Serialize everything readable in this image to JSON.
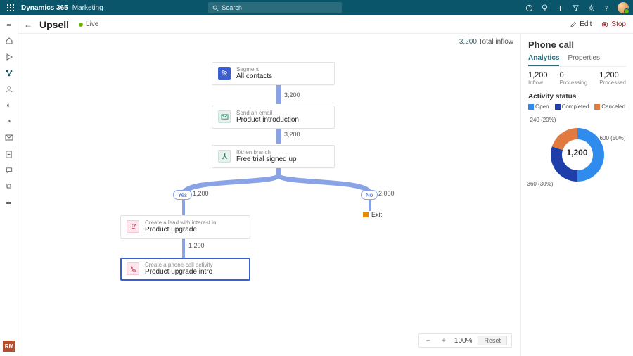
{
  "topbar": {
    "brand": "Dynamics 365",
    "app": "Marketing",
    "search_placeholder": "Search"
  },
  "page": {
    "title": "Upsell",
    "status": "Live",
    "edit_label": "Edit",
    "stop_label": "Stop"
  },
  "rm_badge": "RM",
  "canvas": {
    "total_inflow_value": "3,200",
    "total_inflow_label": "Total inflow",
    "zoom": "100%",
    "reset_label": "Reset",
    "nodes": {
      "segment": {
        "type": "Segment",
        "title": "All contacts"
      },
      "email": {
        "type": "Send an email",
        "title": "Product introduction"
      },
      "branch": {
        "type": "If/then branch",
        "title": "Free trial signed up"
      },
      "lead": {
        "type": "Create a lead with interest in",
        "title": "Product upgrade"
      },
      "phone": {
        "type": "Create a phone-call activity",
        "title": "Product upgrade intro"
      }
    },
    "edge_labels": {
      "seg_email": "3,200",
      "email_branch": "3,200",
      "yes": "Yes",
      "yes_count": "1,200",
      "no": "No",
      "no_count": "2,000",
      "lead_phone": "1,200",
      "exit": "Exit"
    }
  },
  "sidepanel": {
    "title": "Phone call",
    "tabs": {
      "analytics": "Analytics",
      "properties": "Properties"
    },
    "stats": [
      {
        "value": "1,200",
        "label": "Inflow"
      },
      {
        "value": "0",
        "label": "Processing"
      },
      {
        "value": "1,200",
        "label": "Processed"
      }
    ],
    "activity_status_title": "Activity status",
    "legend": [
      {
        "label": "Open",
        "color": "#2f8ced"
      },
      {
        "label": "Completed",
        "color": "#1e3fa9"
      },
      {
        "label": "Canceled",
        "color": "#e07a3e"
      }
    ],
    "donut_center": "1,200",
    "donut_labels": {
      "open": "600 (50%)",
      "completed": "360 (30%)",
      "canceled": "240 (20%)"
    }
  },
  "chart_data": {
    "type": "pie",
    "title": "Activity status",
    "series": [
      {
        "name": "Open",
        "value": 600,
        "pct": 50,
        "color": "#2f8ced"
      },
      {
        "name": "Completed",
        "value": 360,
        "pct": 30,
        "color": "#1e3fa9"
      },
      {
        "name": "Canceled",
        "value": 240,
        "pct": 20,
        "color": "#e07a3e"
      }
    ],
    "total": 1200
  }
}
